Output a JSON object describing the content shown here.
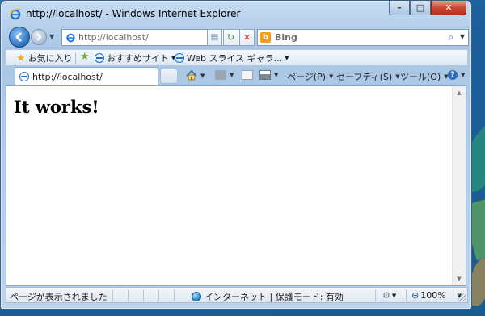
{
  "window": {
    "title": "http://localhost/ - Windows Internet Explorer"
  },
  "navigation": {
    "address_value": "http://localhost/",
    "search_placeholder": "Bing",
    "bing_logo_letter": "b"
  },
  "favorites_bar": {
    "favorites_label": "お気に入り",
    "suggested_sites_label": "おすすめサイト",
    "web_slice_label": "Web スライス ギャラ..."
  },
  "tab": {
    "label": "http://localhost/"
  },
  "command_bar": {
    "page_label": "ページ(P)",
    "safety_label": "セーフティ(S)",
    "tools_label": "ツール(O)"
  },
  "content": {
    "heading": "It works!"
  },
  "status_bar": {
    "status_text": "ページが表示されました",
    "zone_text": "インターネット | 保護モード: 有効",
    "zoom": "100%"
  },
  "colors": {
    "accent": "#2b6fbf",
    "close_button": "#c74a32"
  }
}
